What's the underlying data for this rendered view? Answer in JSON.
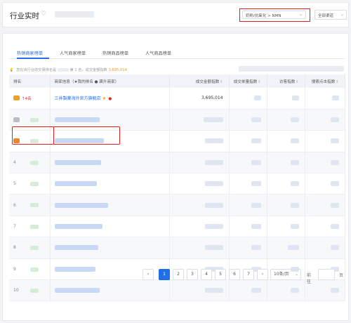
{
  "header": {
    "title": "行业实时",
    "category_select": "奶粉/抗氧化 > NMN",
    "channel_select": "全部渠道"
  },
  "tabs": [
    {
      "label": "热销商家榜单",
      "active": true
    },
    {
      "label": "人气商家榜单",
      "active": false
    },
    {
      "label": "热销商品榜单",
      "active": false
    },
    {
      "label": "人气商品榜单",
      "active": false
    }
  ],
  "notice": {
    "prefix": "您在该行业的交易排名是",
    "rank_text": "第 1 名，成交金额指数",
    "value": "3,695,014"
  },
  "table": {
    "columns": [
      "排名",
      "商家信息（★我的排名 ● 飙升商家）",
      "成交金额指数",
      "成交单量指数",
      "访客指数",
      "搜索点击指数"
    ],
    "rows": [
      {
        "rank": "",
        "rank_change": "↑4名",
        "shop": "三井製薬海外官方旗舰店",
        "gmv": "3,695,014"
      },
      {
        "rank": "",
        "rank_change": "",
        "shop": "",
        "gmv": ""
      },
      {
        "rank": "",
        "rank_change": "",
        "shop": "",
        "gmv": ""
      },
      {
        "rank": "4",
        "rank_change": "",
        "shop": "",
        "gmv": ""
      },
      {
        "rank": "5",
        "rank_change": "",
        "shop": "",
        "gmv": ""
      },
      {
        "rank": "6",
        "rank_change": "",
        "shop": "",
        "gmv": ""
      },
      {
        "rank": "7",
        "rank_change": "",
        "shop": "",
        "gmv": ""
      },
      {
        "rank": "8",
        "rank_change": "",
        "shop": "",
        "gmv": ""
      },
      {
        "rank": "9",
        "rank_change": "",
        "shop": "",
        "gmv": ""
      },
      {
        "rank": "10",
        "rank_change": "",
        "shop": "",
        "gmv": ""
      }
    ]
  },
  "pagination": {
    "prev": "‹",
    "pages": [
      "1",
      "2",
      "3",
      "4",
      "5",
      "6",
      "7"
    ],
    "next": "›",
    "active_page": "1",
    "page_size": "10条/页",
    "goto_label": "前往",
    "page_unit": "页"
  },
  "colors": {
    "accent": "#1f6fe8",
    "highlight": "#e02020"
  }
}
